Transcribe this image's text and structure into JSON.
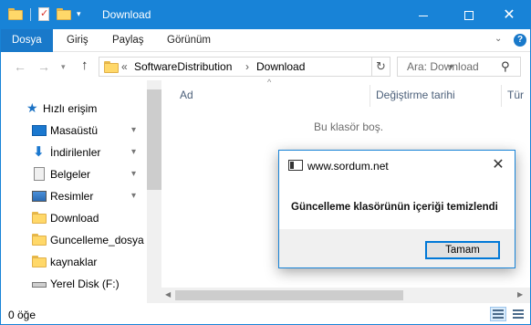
{
  "window": {
    "title": "Download",
    "accent_color": "#1883d7",
    "controls": {
      "minimize": "—",
      "maximize": "□",
      "close": "✕"
    }
  },
  "ribbon": {
    "tabs": [
      {
        "label": "Dosya",
        "active": true
      },
      {
        "label": "Giriş"
      },
      {
        "label": "Paylaş"
      },
      {
        "label": "Görünüm"
      }
    ],
    "help": "?",
    "chevron": "⌄"
  },
  "navbar": {
    "back": "←",
    "forward": "→",
    "recent": "⌄",
    "up": "↑",
    "breadcrumb_overflow": "«",
    "breadcrumbs": [
      "SoftwareDistribution",
      "Download"
    ],
    "breadcrumb_sep": "›",
    "refresh": "↻",
    "search_placeholder": "Ara: Download",
    "search_icon": "search-icon"
  },
  "sidebar": {
    "items": [
      {
        "label": "Hızlı erişim",
        "icon": "star-icon",
        "pinned": false
      },
      {
        "label": "Masaüstü",
        "icon": "desktop-icon",
        "pinned": true
      },
      {
        "label": "İndirilenler",
        "icon": "download-icon",
        "pinned": true
      },
      {
        "label": "Belgeler",
        "icon": "document-icon",
        "pinned": true
      },
      {
        "label": "Resimler",
        "icon": "picture-icon",
        "pinned": true
      },
      {
        "label": "Download",
        "icon": "folder-icon",
        "pinned": false
      },
      {
        "label": "Guncelleme_dosya",
        "icon": "folder-icon",
        "pinned": false
      },
      {
        "label": "kaynaklar",
        "icon": "folder-icon",
        "pinned": false
      },
      {
        "label": "Yerel Disk (F:)",
        "icon": "drive-icon",
        "pinned": false
      }
    ],
    "pin_glyph": "📌"
  },
  "content": {
    "columns": [
      "Ad",
      "Değiştirme tarihi",
      "Tür"
    ],
    "sort_glyph": "^",
    "empty_message": "Bu klasör boş."
  },
  "statusbar": {
    "item_count": "0 öğe"
  },
  "dialog": {
    "title": "www.sordum.net",
    "close": "✕",
    "message": "Güncelleme klasörünün içeriği temizlendi",
    "ok_label": "Tamam"
  }
}
